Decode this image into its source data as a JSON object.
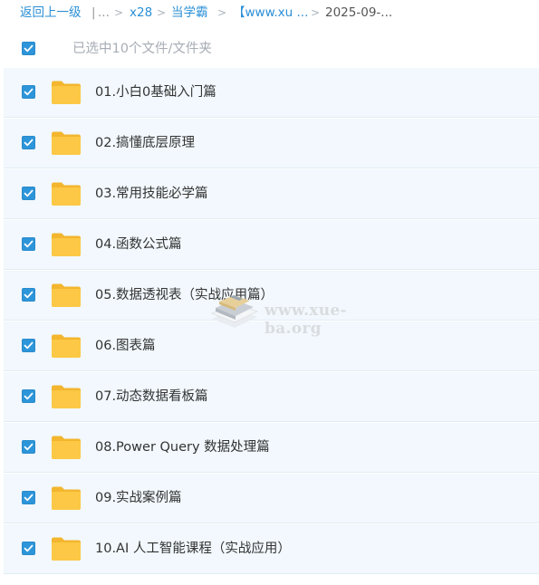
{
  "breadcrumb": {
    "back": "返回上一级",
    "divider": "|",
    "ellipsis": "...",
    "sep": ">",
    "items": [
      "x28",
      "当学霸",
      "【www.xu ...",
      "2025-09-..."
    ]
  },
  "selection": {
    "text": "已选中10个文件/文件夹",
    "checked": true
  },
  "files": [
    {
      "name": "01.小白0基础入门篇",
      "type": "folder",
      "checked": true
    },
    {
      "name": "02.搞懂底层原理",
      "type": "folder",
      "checked": true
    },
    {
      "name": "03.常用技能必学篇",
      "type": "folder",
      "checked": true
    },
    {
      "name": "04.函数公式篇",
      "type": "folder",
      "checked": true
    },
    {
      "name": "05.数据透视表（实战应用篇）",
      "type": "folder",
      "checked": true
    },
    {
      "name": "06.图表篇",
      "type": "folder",
      "checked": true
    },
    {
      "name": "07.动态数据看板篇",
      "type": "folder",
      "checked": true
    },
    {
      "name": "08.Power Query 数据处理篇",
      "type": "folder",
      "checked": true
    },
    {
      "name": "09.实战案例篇",
      "type": "folder",
      "checked": true
    },
    {
      "name": "10.AI 人工智能课程（实战应用）",
      "type": "folder",
      "checked": true
    }
  ],
  "watermark": {
    "text": "www.xue-ba.org"
  },
  "colors": {
    "accent": "#2d95d9",
    "row_bg": "#f2f8fd",
    "folder": "#fcc845"
  },
  "icons": {
    "checkbox": "checkbox-checked-icon",
    "folder": "folder-icon",
    "watermark_logo": "book-stack-icon"
  }
}
